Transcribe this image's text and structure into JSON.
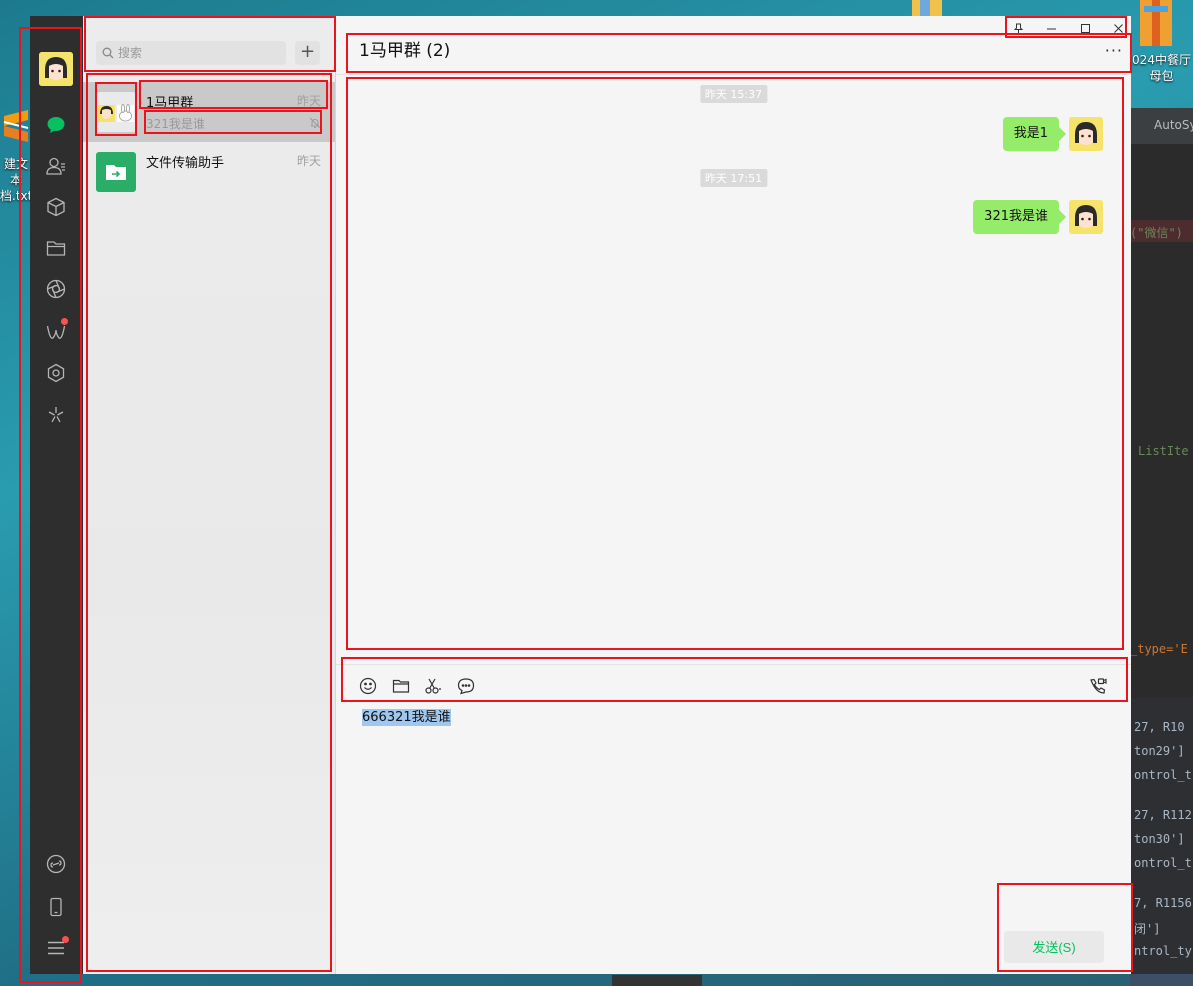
{
  "desktop": {
    "left_icon_label_line1": "建文本",
    "left_icon_label_line2": "档.txt",
    "right_icon_label_line1": "024中餐厅",
    "right_icon_label_line2": "母包"
  },
  "ide": {
    "tab_label": "AutoSy",
    "code_lines": [
      "(\"微信\")",
      "ListIte",
      "_type='E"
    ],
    "console_lines": [
      "27, R10",
      "ton29']",
      "ontrol_t",
      "27, R112",
      "ton30']",
      "ontrol_t",
      "7, R1156",
      "闭']",
      "ntrol_ty"
    ]
  },
  "nav": {
    "chat_badge": true,
    "moments_badge": true,
    "menu_badge": true
  },
  "search": {
    "placeholder": "搜索",
    "add_label": "+"
  },
  "chats": [
    {
      "name": "1马甲群",
      "time": "昨天",
      "preview": "321我是谁",
      "muted": true,
      "active": true
    },
    {
      "name": "文件传输助手",
      "time": "昨天",
      "preview": "",
      "muted": false,
      "active": false
    }
  ],
  "chat": {
    "title": "1马甲群 (2)",
    "more_label": "···",
    "messages": [
      {
        "timestamp": "昨天 15:37",
        "text": "我是1"
      },
      {
        "timestamp": "昨天 17:51",
        "text": "321我是谁"
      }
    ],
    "input_text": "666321我是谁",
    "send_label": "发送(S)"
  },
  "colors": {
    "nav_bg": "#2e2e2e",
    "accent_green": "#07c160",
    "bubble_green": "#95ec69",
    "annotation_red": "#e8141e"
  },
  "icons": [
    "chat-icon",
    "contacts-icon",
    "favorites-icon",
    "folder-icon",
    "moments-icon",
    "channels-icon",
    "mini-programs-icon",
    "search-discover-icon",
    "mini-program-link-icon",
    "phone-icon",
    "menu-icon",
    "emoji-icon",
    "file-icon",
    "scissors-icon",
    "chat-history-icon",
    "video-call-icon",
    "pin-icon",
    "minimize-icon",
    "maximize-icon",
    "close-icon"
  ]
}
